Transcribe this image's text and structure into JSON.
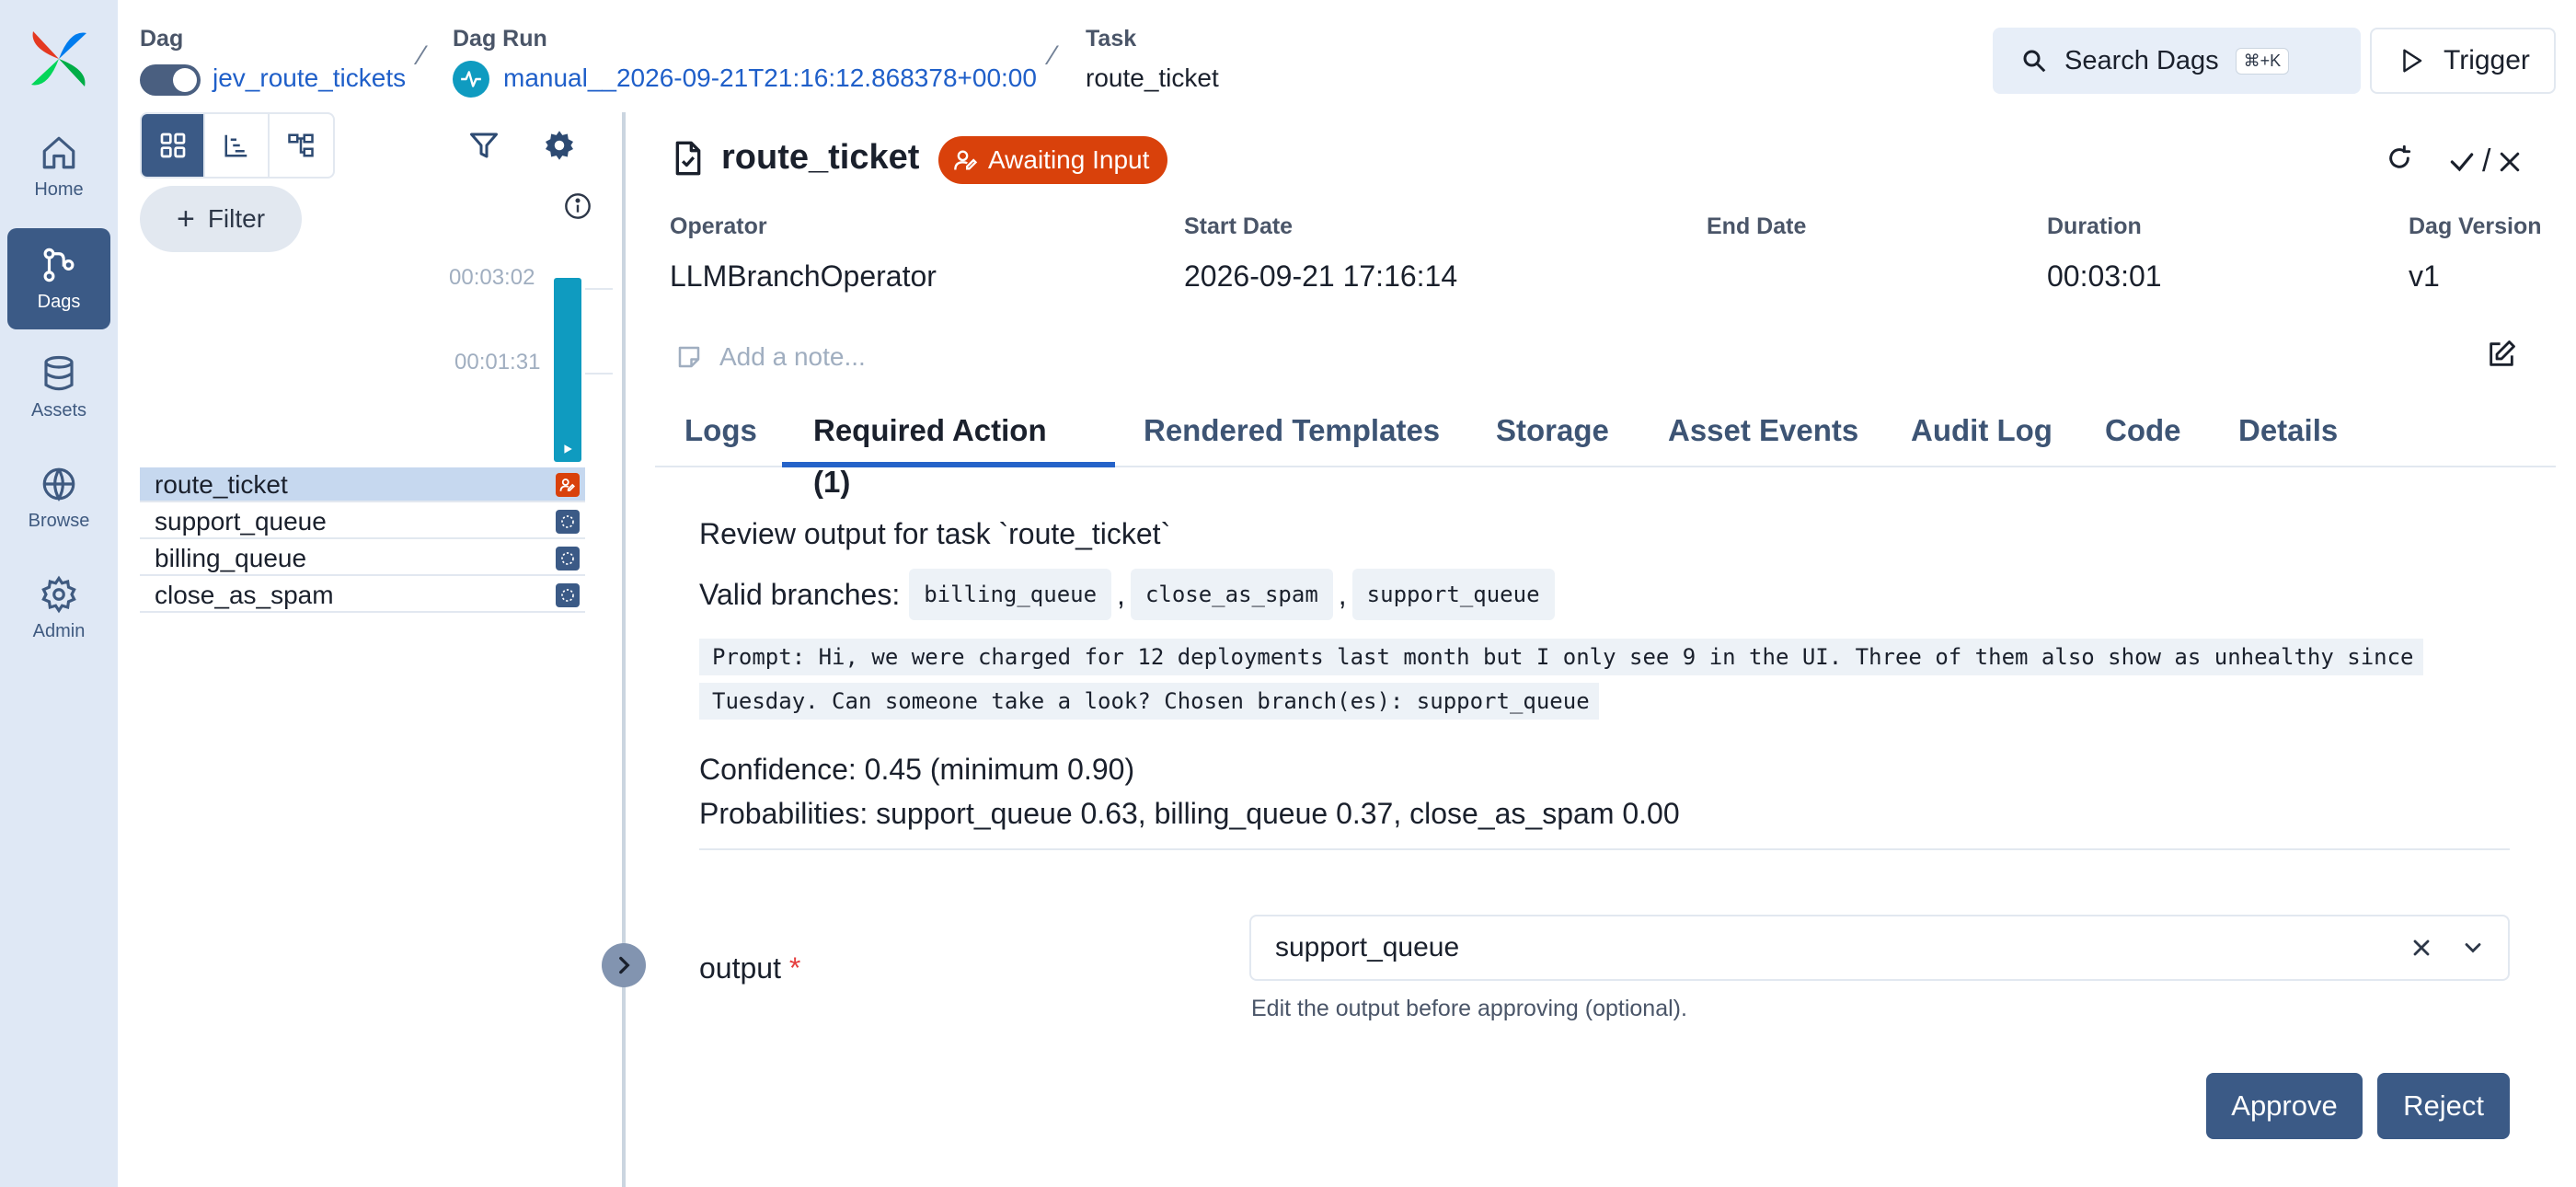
{
  "nav": {
    "items": [
      {
        "label": "Home",
        "icon": "home-icon"
      },
      {
        "label": "Dags",
        "icon": "dags-icon",
        "active": true
      },
      {
        "label": "Assets",
        "icon": "database-icon"
      },
      {
        "label": "Browse",
        "icon": "globe-icon"
      },
      {
        "label": "Admin",
        "icon": "gear-icon"
      }
    ]
  },
  "breadcrumb": {
    "dag_header": "Dag",
    "dag_name": "jev_route_tickets",
    "dagrun_header": "Dag Run",
    "dagrun_id": "manual__2026-09-21T21:16:12.868378+00:00",
    "task_header": "Task",
    "task_id": "route_ticket"
  },
  "header": {
    "search_label": "Search Dags",
    "search_shortcut": "⌘+K",
    "trigger_label": "Trigger"
  },
  "grid": {
    "filter_label": "Filter",
    "ticks": [
      "00:03:02",
      "00:01:31"
    ],
    "tasks": [
      {
        "name": "route_ticket",
        "state": "awaiting-input"
      },
      {
        "name": "support_queue",
        "state": "scheduled"
      },
      {
        "name": "billing_queue",
        "state": "scheduled"
      },
      {
        "name": "close_as_spam",
        "state": "scheduled"
      }
    ]
  },
  "task": {
    "title": "route_ticket",
    "badge": "Awaiting Input",
    "meta": {
      "operator_label": "Operator",
      "operator": "LLMBranchOperator",
      "start_label": "Start Date",
      "start": "2026-09-21 17:16:14",
      "end_label": "End Date",
      "end": "",
      "duration_label": "Duration",
      "duration": "00:03:01",
      "version_label": "Dag Version",
      "version": "v1"
    },
    "note_placeholder": "Add a note...",
    "tabs": [
      "Logs",
      "Required Action (1)",
      "Rendered Templates",
      "Storage",
      "Asset Events",
      "Audit Log",
      "Code",
      "Details"
    ],
    "active_tab": "Required Action (1)"
  },
  "required_action": {
    "heading": "Review output for task `route_ticket`",
    "valid_label": "Valid branches:",
    "branches": [
      "billing_queue",
      "close_as_spam",
      "support_queue"
    ],
    "prompt": "Prompt: Hi, we were charged for 12 deployments last month but I only see 9 in the UI. Three of them also show as unhealthy since Tuesday. Can someone take a look? Chosen branch(es): support_queue",
    "confidence": "Confidence: 0.45 (minimum 0.90)",
    "probabilities": "Probabilities: support_queue 0.63, billing_queue 0.37, close_as_spam 0.00",
    "output_label": "output",
    "required_mark": "*",
    "output_value": "support_queue",
    "helper": "Edit the output before approving (optional).",
    "approve": "Approve",
    "reject": "Reject"
  },
  "colors": {
    "accent": "#3b5a86",
    "badge": "#d9410b",
    "link": "#1f5fc9",
    "running_bar": "#0f9bc0"
  }
}
